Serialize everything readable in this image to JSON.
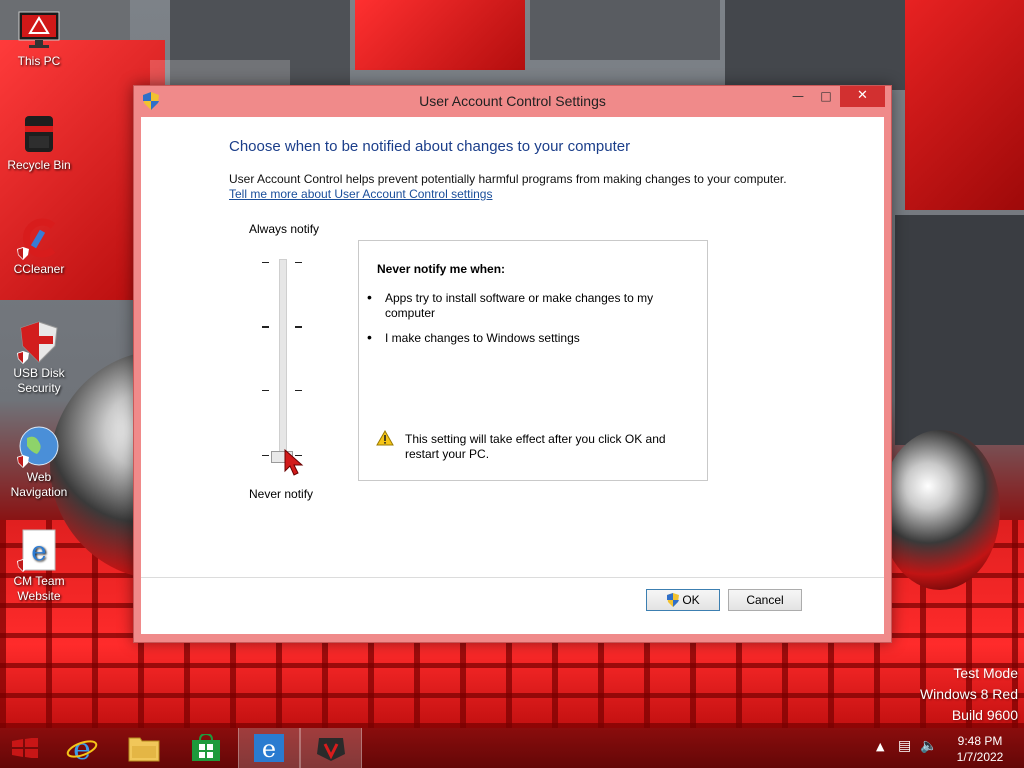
{
  "desktop": {
    "icons": [
      {
        "label": "This PC",
        "icon": "monitor-icon"
      },
      {
        "label": "Recycle Bin",
        "icon": "recycle-bin-icon"
      },
      {
        "label": "CCleaner",
        "icon": "ccleaner-icon"
      },
      {
        "label": "USB Disk Security",
        "icon": "usb-shield-icon"
      },
      {
        "label": "Web Navigation",
        "icon": "globe-icon"
      },
      {
        "label": "CM Team Website",
        "icon": "ie-document-icon"
      }
    ],
    "watermark": {
      "line1": "Test Mode",
      "line2": "Windows 8 Red",
      "line3": "Build 9600"
    }
  },
  "window": {
    "title": "User Account Control Settings",
    "heading": "Choose when to be notified about changes to your computer",
    "description": "User Account Control helps prevent potentially harmful programs from making changes to your computer.",
    "learn_link": "Tell me more about User Account Control settings",
    "slider": {
      "top_label": "Always notify",
      "bottom_label": "Never notify",
      "levels": 4,
      "selected_level": 1
    },
    "info": {
      "title": "Never notify me when:",
      "bullets": [
        "Apps try to install software or make changes to my computer",
        "I make changes to Windows settings"
      ],
      "warning": "This setting will take effect after you click OK and restart your PC."
    },
    "buttons": {
      "ok": "OK",
      "cancel": "Cancel"
    }
  },
  "taskbar": {
    "time": "9:48 PM",
    "date": "1/7/2022",
    "accent": "#7a0a0a"
  }
}
